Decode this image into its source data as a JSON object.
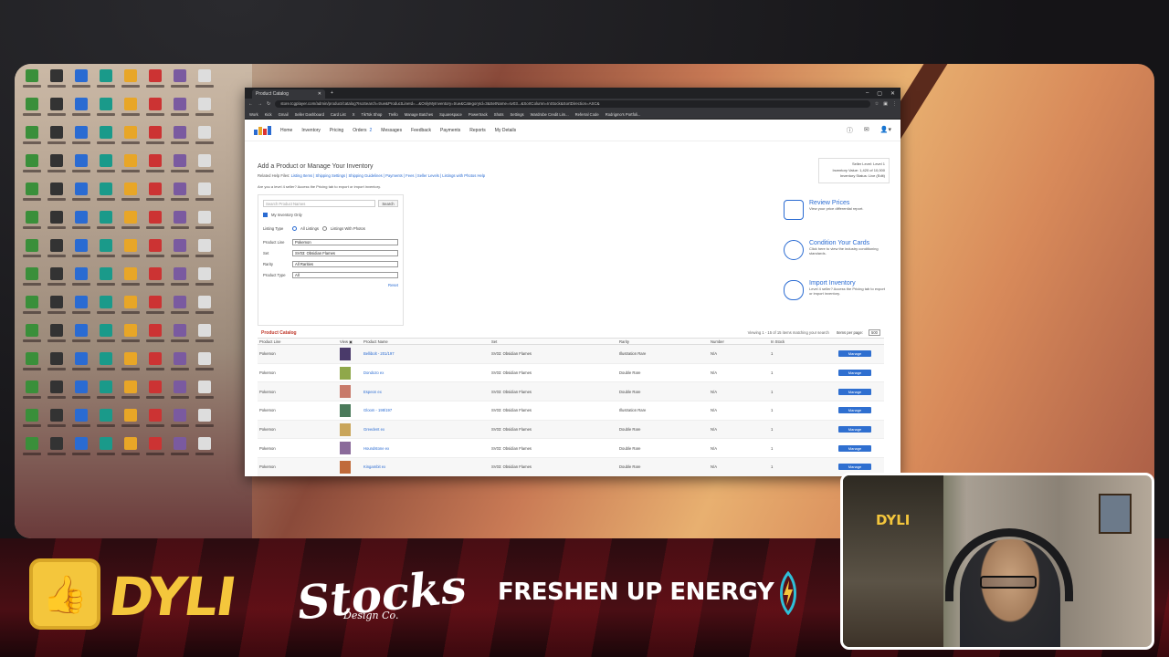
{
  "browser": {
    "tab_title": "Product Catalog",
    "url": "store.tcgplayer.com/admin/product/catalog?IsoSearch=true&ProductLineId=...&OnlyMyInventory=true&CategoryId=3&SetName=sv03...&SortColumn=InStock&SortDirection=ASC&",
    "bookmarks": [
      "Work",
      "Kick",
      "Gmail",
      "Seller Dashboard",
      "Card List",
      "X",
      "TikTok Shop",
      "Trello",
      "Manage Batches",
      "Squarespace",
      "Powertrack",
      "Shots",
      "Settings",
      "Wardrobe Credit Lim...",
      "Referral Code",
      "Rodrigmo's Portfoli..."
    ]
  },
  "topnav": {
    "logo_text": "TCGPLAYER",
    "items": [
      "Home",
      "Inventory",
      "Pricing",
      "Orders",
      "Messages",
      "Feedback",
      "Payments",
      "Reports",
      "My Details"
    ],
    "orders_badge": "2"
  },
  "page": {
    "heading": "Add a Product or Manage Your Inventory",
    "help_prefix": "Related Help Files:",
    "help_links": "Listing Items | Shipping Settings | Shipping Guidelines | Payments | Fees | Seller Levels | Listings with Photos Help",
    "seller_prompt": "Are you a level 4 seller? Access the Pricing tab to export or import inventory.",
    "seller_box": {
      "level": "Seller Level: Level 1",
      "inventory": "Inventory Value: 1,420 of 10,000",
      "status": "Inventory Status: Live (Edit)"
    }
  },
  "filters": {
    "search_placeholder": "Search Product Names",
    "search_button": "Search",
    "my_inventory_only": "My Inventory Only",
    "listing_type_label": "Listing Type",
    "listing_all": "All Listings",
    "listing_photos": "Listings With Photos",
    "product_line_label": "Product Line",
    "product_line_value": "Pokemon",
    "set_label": "Set",
    "set_value": "SV03: Obsidian Flames",
    "rarity_label": "Rarity",
    "rarity_value": "All Rarities",
    "product_type_label": "Product Type",
    "product_type_value": "All",
    "reset": "Reset"
  },
  "promos": [
    {
      "title": "Review Prices",
      "body": "View your price differential report."
    },
    {
      "title": "Condition Your Cards",
      "body": "Click here to view the industry conditioning standards."
    },
    {
      "title": "Import Inventory",
      "body": "Level 4 seller? Access the Pricing tab to export or import inventory."
    }
  ],
  "table": {
    "title": "Product Catalog",
    "viewing": "Viewing 1 - 15 of 15 items matching your search",
    "per_page_label": "Items per page:",
    "per_page_value": "500",
    "headers": [
      "Product Line",
      "View ▣",
      "Product Name",
      "Set",
      "Rarity",
      "Number",
      "In Stock",
      ""
    ],
    "rows": [
      {
        "line": "Pokemon",
        "name": "Bellibolt - 201/197",
        "set": "SV03: Obsidian Flames",
        "rarity": "Illustration Rare",
        "number": "N/A",
        "stock": "1",
        "action": "Manage",
        "thumb": "#4a3a6a"
      },
      {
        "line": "Pokemon",
        "name": "Dondozo ex",
        "set": "SV03: Obsidian Flames",
        "rarity": "Double Rare",
        "number": "N/A",
        "stock": "1",
        "action": "Manage",
        "thumb": "#8fa84a"
      },
      {
        "line": "Pokemon",
        "name": "Espeon ex",
        "set": "SV03: Obsidian Flames",
        "rarity": "Double Rare",
        "number": "N/A",
        "stock": "1",
        "action": "Manage",
        "thumb": "#c87a6a"
      },
      {
        "line": "Pokemon",
        "name": "Gloom - 198/197",
        "set": "SV03: Obsidian Flames",
        "rarity": "Illustration Rare",
        "number": "N/A",
        "stock": "1",
        "action": "Manage",
        "thumb": "#4a7a5a"
      },
      {
        "line": "Pokemon",
        "name": "Greedent ex",
        "set": "SV03: Obsidian Flames",
        "rarity": "Double Rare",
        "number": "N/A",
        "stock": "1",
        "action": "Manage",
        "thumb": "#c9a55a"
      },
      {
        "line": "Pokemon",
        "name": "Houndstone ex",
        "set": "SV03: Obsidian Flames",
        "rarity": "Double Rare",
        "number": "N/A",
        "stock": "1",
        "action": "Manage",
        "thumb": "#8a6a9a"
      },
      {
        "line": "Pokemon",
        "name": "Kingambit ex",
        "set": "SV03: Obsidian Flames",
        "rarity": "Double Rare",
        "number": "N/A",
        "stock": "1",
        "action": "Manage",
        "thumb": "#c06a3a"
      }
    ]
  },
  "overlay": {
    "dyli": "DYLI",
    "stocks": "Stocks",
    "stocks_sub": "Design Co.",
    "energy": "FRESHEN UP ENERGY",
    "cam_sign": "DYLI"
  },
  "colors": {
    "accent": "#2a6bd2",
    "manage_button": "#2f6fd0",
    "brand_yellow": "#f4c63c"
  }
}
